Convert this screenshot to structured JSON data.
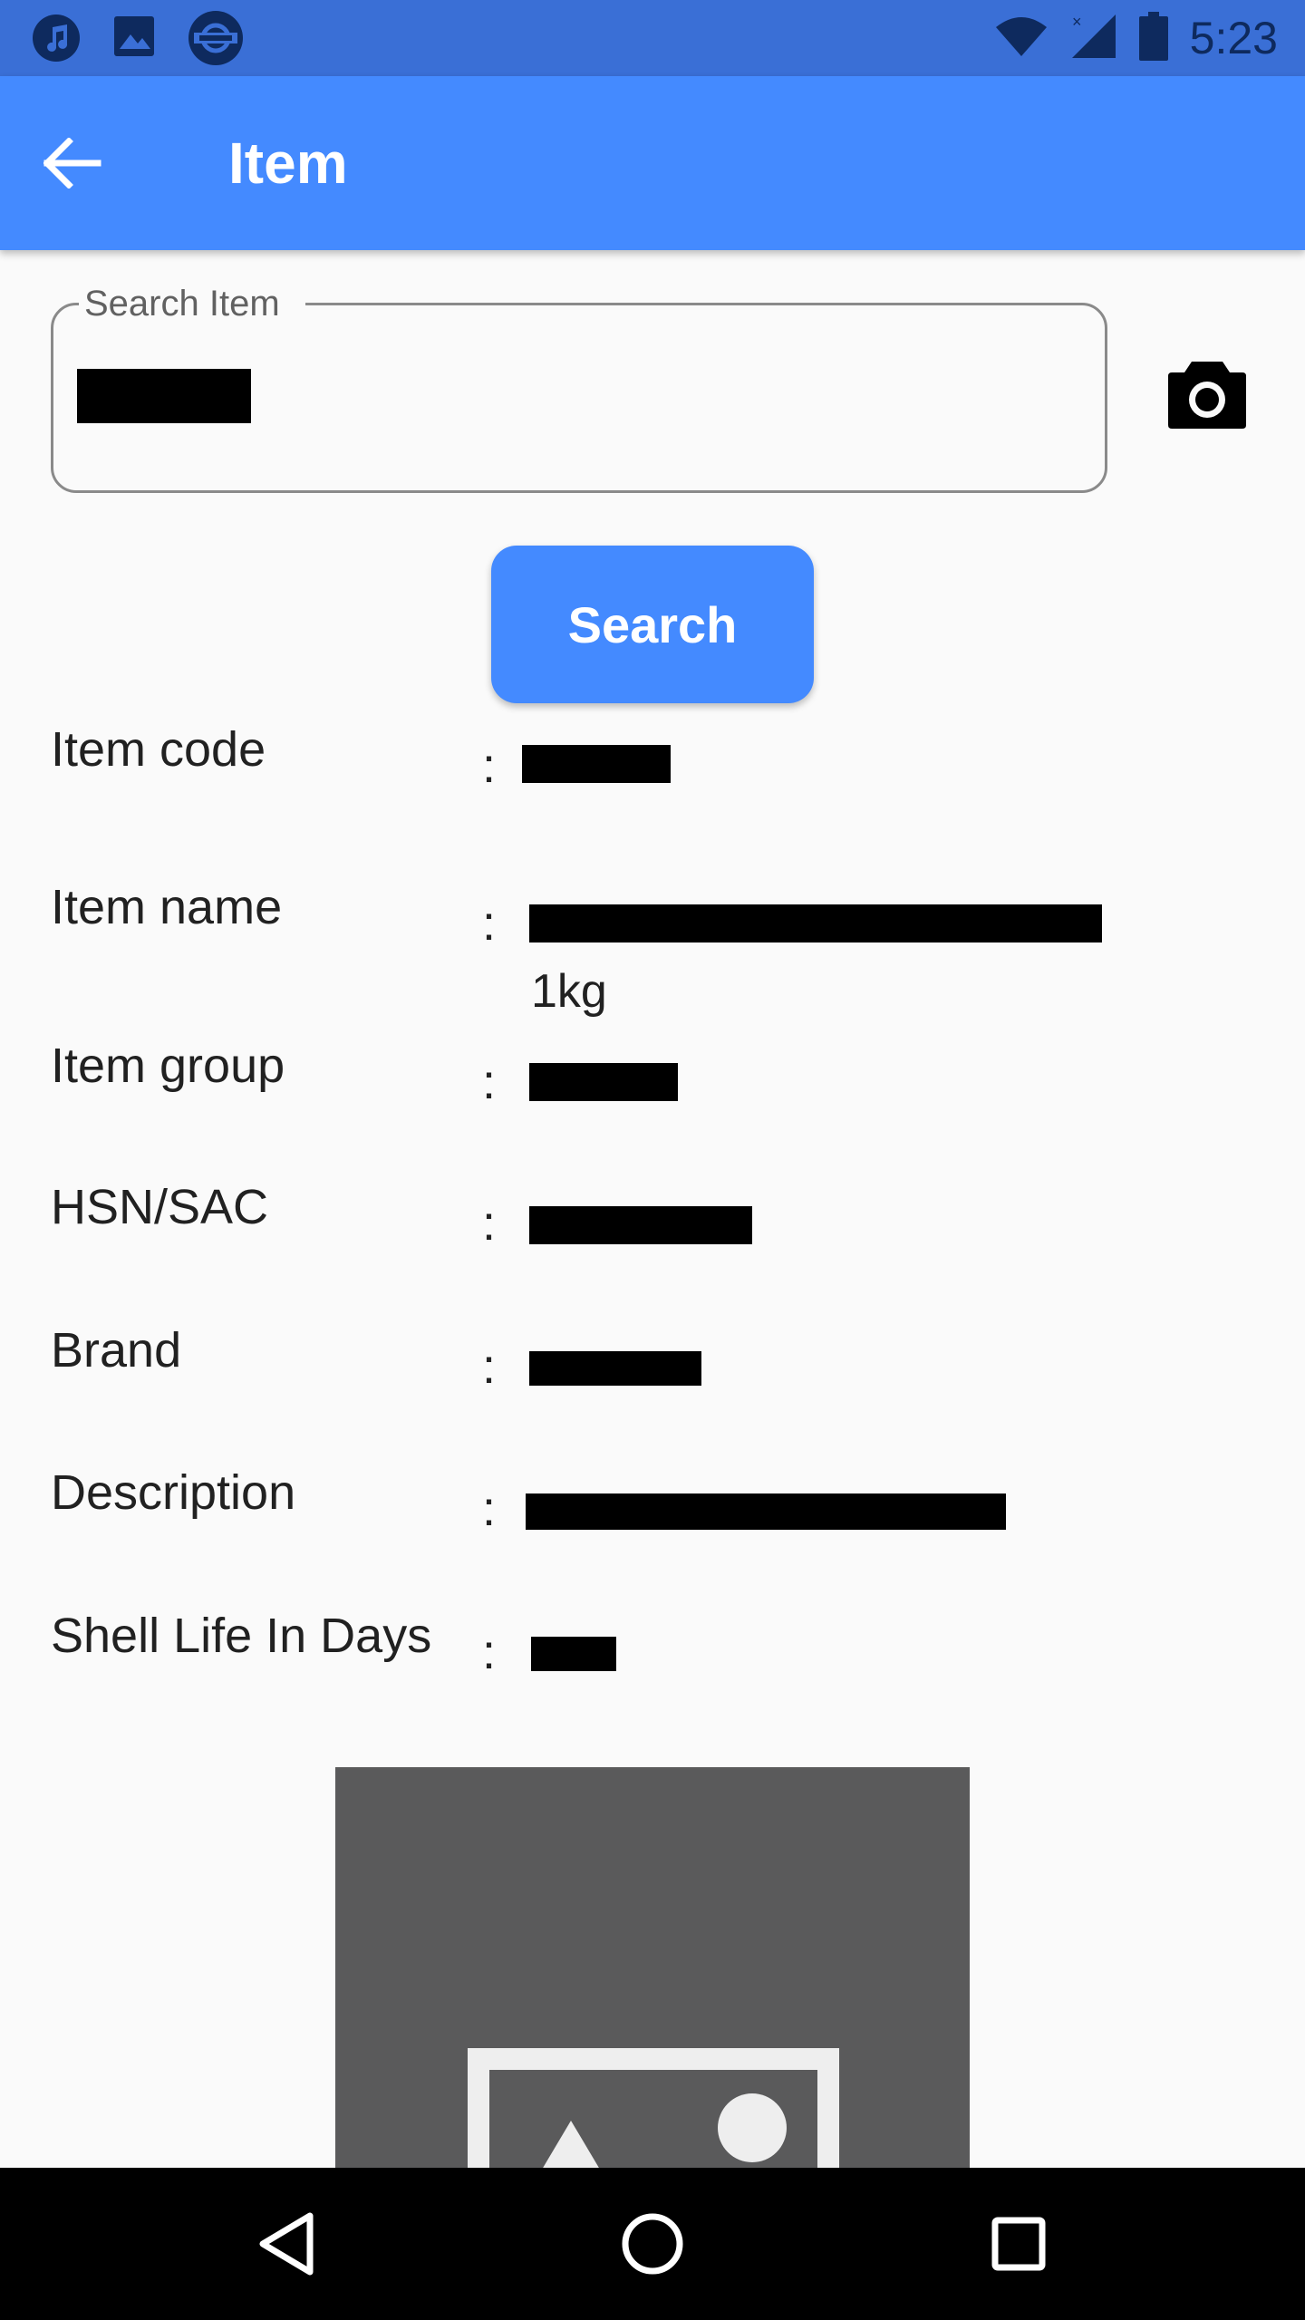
{
  "status_bar": {
    "time": "5:23",
    "left_icons": [
      "music-note-icon",
      "image-icon",
      "sync-icon"
    ],
    "right_icons": [
      "wifi-icon",
      "cell-signal-icon",
      "battery-icon"
    ]
  },
  "app_bar": {
    "title": "Item",
    "back_icon": "arrow-left-icon"
  },
  "search": {
    "label": "Search Item",
    "value": "",
    "camera_icon": "camera-icon",
    "button_label": "Search"
  },
  "details": {
    "item_code": {
      "label": "Item code",
      "colon": ":"
    },
    "item_name": {
      "label": "Item name",
      "colon": ":",
      "extra": "1kg"
    },
    "item_group": {
      "label": "Item group",
      "colon": ":"
    },
    "hsn_sac": {
      "label": "HSN/SAC",
      "colon": ":"
    },
    "brand": {
      "label": "Brand",
      "colon": ":"
    },
    "description": {
      "label": "Description",
      "colon": ":"
    },
    "shelf_life": {
      "label": "Shell Life In Days",
      "colon": ":"
    }
  },
  "image": {
    "icon": "image-placeholder-icon"
  },
  "nav_bar": {
    "back_icon": "nav-back-icon",
    "home_icon": "nav-home-icon",
    "recents_icon": "nav-recents-icon"
  },
  "colors": {
    "status_bar": "#3a6fd6",
    "app_bar": "#448aff",
    "button": "#448aff",
    "image_placeholder": "#5a5a5b"
  }
}
